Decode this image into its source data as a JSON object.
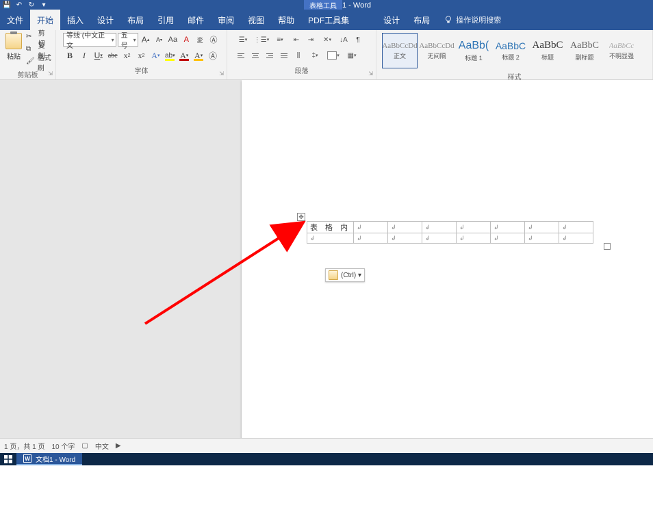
{
  "title": "文档1 - Word",
  "contextual_tab": "表格工具",
  "qat": {
    "save": "保存",
    "undo": "↶",
    "redo": "↷",
    "customize": "▾"
  },
  "tabs": [
    "文件",
    "开始",
    "插入",
    "设计",
    "布局",
    "引用",
    "邮件",
    "审阅",
    "视图",
    "帮助",
    "PDF工具集",
    "设计",
    "布局"
  ],
  "active_tab_index": 1,
  "tellme": "操作说明搜索",
  "clipboard": {
    "paste": "粘贴",
    "cut": "剪切",
    "copy": "复制",
    "format_painter": "格式刷",
    "group_label": "剪贴板"
  },
  "font": {
    "font_name": "等线 (中文正文",
    "font_size": "五号",
    "grow": "A",
    "shrink": "A",
    "change_case": "Aa",
    "clear_format": "A",
    "phonetic": "拼",
    "enclose": "A",
    "bold": "B",
    "italic": "I",
    "underline": "U",
    "strike": "abc",
    "sub": "x₂",
    "sup": "x²",
    "effects": "A",
    "highlight": "ab",
    "color": "A",
    "shading": "A",
    "group_label": "字体"
  },
  "paragraph": {
    "group_label": "段落"
  },
  "styles": {
    "group_label": "样式",
    "items": [
      {
        "preview": "AaBbCcDd",
        "label": "正文"
      },
      {
        "preview": "AaBbCcDd",
        "label": "无间隔"
      },
      {
        "preview": "AaBb(",
        "label": "标题 1"
      },
      {
        "preview": "AaBbC",
        "label": "标题 2"
      },
      {
        "preview": "AaBbC",
        "label": "标题"
      },
      {
        "preview": "AaBbC",
        "label": "副标题"
      },
      {
        "preview": "AaBbCc",
        "label": "不明显强"
      }
    ]
  },
  "document": {
    "cell_text": "表 格 内",
    "paste_hint": "(Ctrl) ▾"
  },
  "status": {
    "page": "1 页，共 1 页",
    "words": "10 个字",
    "proof_icon": "□",
    "lang": "中文"
  },
  "taskbar": {
    "app": "文档1 - Word"
  }
}
